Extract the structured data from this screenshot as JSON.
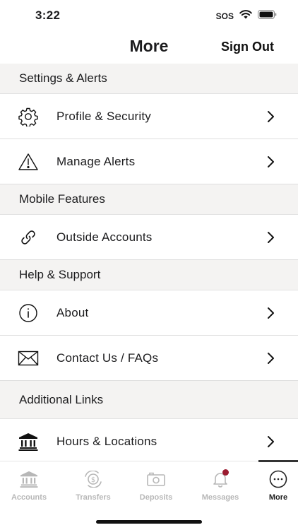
{
  "status": {
    "time": "3:22",
    "sos": "SOS"
  },
  "header": {
    "title": "More",
    "sign_out": "Sign Out"
  },
  "sections": [
    {
      "title": "Settings & Alerts",
      "items": [
        {
          "label": "Profile & Security",
          "icon": "gear-icon"
        },
        {
          "label": "Manage Alerts",
          "icon": "warning-icon"
        }
      ]
    },
    {
      "title": "Mobile Features",
      "items": [
        {
          "label": "Outside Accounts",
          "icon": "link-icon"
        }
      ]
    },
    {
      "title": "Help & Support",
      "items": [
        {
          "label": "About",
          "icon": "info-icon"
        },
        {
          "label": "Contact Us / FAQs",
          "icon": "envelope-icon"
        }
      ]
    },
    {
      "title": "Additional Links",
      "items": [
        {
          "label": "Hours & Locations",
          "icon": "bank-icon"
        }
      ]
    }
  ],
  "tabs": [
    {
      "label": "Accounts",
      "icon": "bank-icon"
    },
    {
      "label": "Transfers",
      "icon": "transfer-icon"
    },
    {
      "label": "Deposits",
      "icon": "camera-icon"
    },
    {
      "label": "Messages",
      "icon": "bell-icon"
    },
    {
      "label": "More",
      "icon": "more-icon",
      "active": true
    }
  ],
  "colors": {
    "accent_badge": "#9b1b30",
    "inactive_tab": "#b7b7b7",
    "section_bg": "#f4f3f2"
  }
}
